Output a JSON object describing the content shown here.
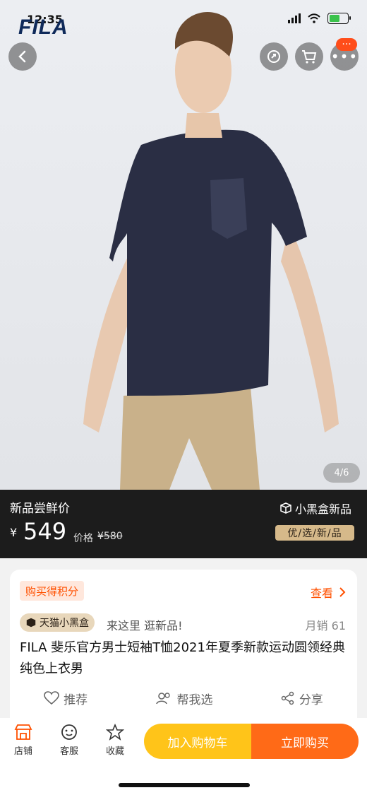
{
  "status_bar": {
    "time": "12:35"
  },
  "hero": {
    "logo_text": "FILA",
    "pager": "4/6",
    "badge": "···"
  },
  "promo": {
    "title": "新品尝鲜价",
    "currency": "¥",
    "price": "549",
    "original_label": "价格",
    "original_price": "¥580",
    "brand_label": "小黑盒新品",
    "tag": "优/选/新/品"
  },
  "product": {
    "points_label": "购买得积分",
    "more_label": "查看",
    "tmall_label": "天猫小黑盒",
    "invite": "来这里 逛新品!",
    "monthly_sales": "月销 61",
    "title": "FILA 斐乐官方男士短袖T恤2021年夏季新款运动圆领经典纯色上衣男",
    "actions": [
      "推荐",
      "帮我选",
      "分享"
    ]
  },
  "bottom_bar": {
    "store": "店铺",
    "service": "客服",
    "favorite": "收藏",
    "add_cart": "加入购物车",
    "buy_now": "立即购买"
  },
  "colors": {
    "accent": "#ff5000",
    "cart": "#ffc419",
    "buy": "#ff6a17",
    "promo_bg": "#1c1c1c"
  },
  "icons": [
    "back-icon",
    "share-refresh-icon",
    "cart-icon",
    "more-icon",
    "store-icon",
    "service-icon",
    "star-icon",
    "heart-icon",
    "people-icon",
    "share-icon",
    "box-icon"
  ]
}
